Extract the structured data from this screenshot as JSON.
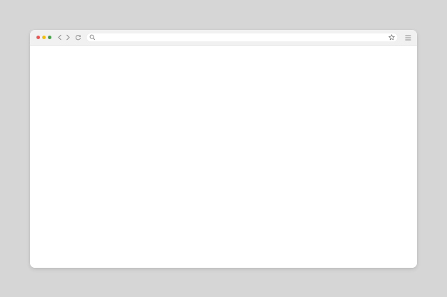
{
  "window": {
    "controls": [
      {
        "name": "close",
        "color": "#ef5350"
      },
      {
        "name": "minimize",
        "color": "#f5c000"
      },
      {
        "name": "maximize",
        "color": "#43a047"
      }
    ]
  },
  "toolbar": {
    "back_icon": "chevron-left-icon",
    "forward_icon": "chevron-right-icon",
    "reload_icon": "reload-icon",
    "menu_icon": "hamburger-menu-icon"
  },
  "address_bar": {
    "value": "",
    "placeholder": "",
    "search_icon": "search-icon",
    "bookmark_icon": "star-icon"
  },
  "colors": {
    "background": "#d6d6d6",
    "toolbar": "#f1f1f1",
    "icon": "#8a8a8a",
    "content": "#ffffff"
  },
  "page": {
    "content": ""
  }
}
